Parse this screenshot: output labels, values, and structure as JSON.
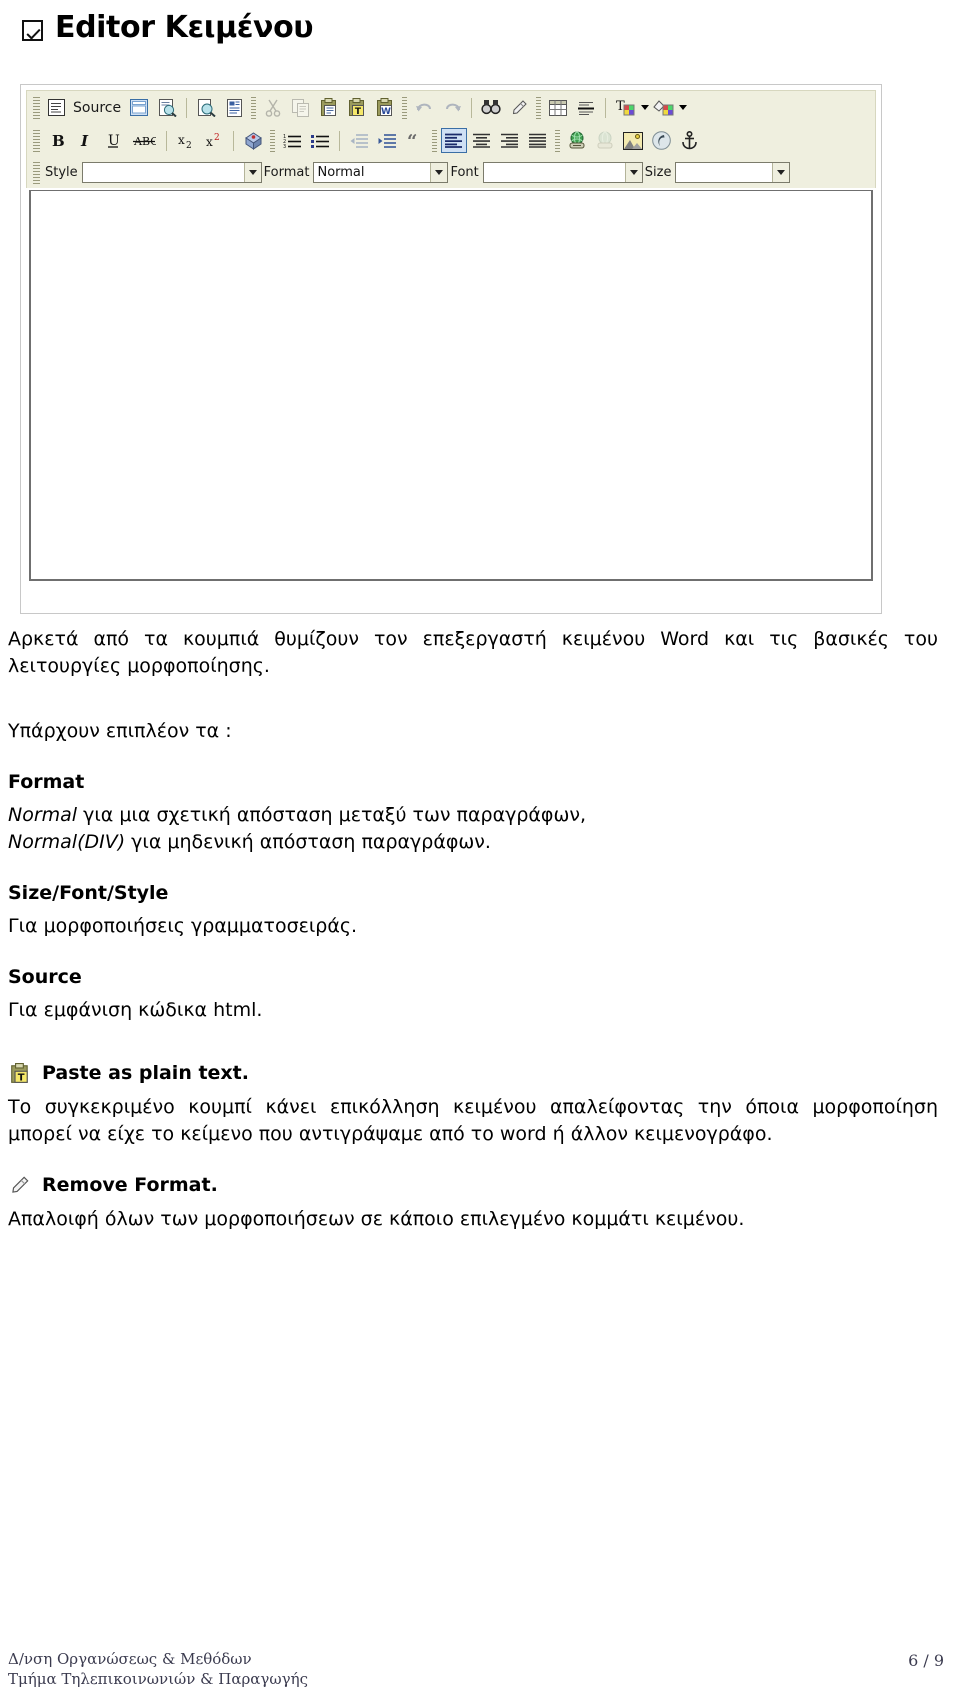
{
  "document": {
    "title": "Editor Κειμένου",
    "title_icon": "checkbox-checked-icon"
  },
  "editor": {
    "toolbar_row1": [
      {
        "name": "source-button",
        "label": "Source",
        "icon": "source-code-icon"
      },
      {
        "name": "templates-button",
        "label": "",
        "icon": "templates-icon"
      },
      {
        "name": "preview-button",
        "label": "",
        "icon": "preview-page-icon"
      },
      {
        "name": "zoom-button",
        "label": "",
        "icon": "magnifier-icon"
      },
      {
        "name": "new-page-button",
        "label": "",
        "icon": "new-page-icon"
      },
      {
        "name": "cut-button",
        "label": "",
        "icon": "scissors-icon"
      },
      {
        "name": "copy-button",
        "label": "",
        "icon": "copy-icon"
      },
      {
        "name": "paste-button",
        "label": "",
        "icon": "paste-icon"
      },
      {
        "name": "paste-text-button",
        "label": "",
        "icon": "paste-as-plain-text-icon"
      },
      {
        "name": "paste-word-button",
        "label": "",
        "icon": "paste-from-word-icon"
      },
      {
        "name": "undo-button",
        "label": "",
        "icon": "undo-arrow-icon"
      },
      {
        "name": "redo-button",
        "label": "",
        "icon": "redo-arrow-icon"
      },
      {
        "name": "find-replace-button",
        "label": "",
        "icon": "binoculars-icon"
      },
      {
        "name": "remove-format-button",
        "label": "",
        "icon": "eraser-icon"
      },
      {
        "name": "table-button",
        "label": "",
        "icon": "table-icon"
      },
      {
        "name": "horizontal-rule-button",
        "label": "",
        "icon": "horizontal-rule-icon"
      },
      {
        "name": "text-color-button",
        "label": "",
        "icon": "text-color-icon"
      },
      {
        "name": "background-color-button",
        "label": "",
        "icon": "background-color-icon"
      }
    ],
    "toolbar_row2": [
      {
        "name": "bold-button",
        "label": "B",
        "icon": "bold-icon"
      },
      {
        "name": "italic-button",
        "label": "I",
        "icon": "italic-icon"
      },
      {
        "name": "underline-button",
        "label": "U",
        "icon": "underline-icon"
      },
      {
        "name": "strikethrough-button",
        "label": "ABC",
        "icon": "strikethrough-icon"
      },
      {
        "name": "subscript-button",
        "label": "x2",
        "icon": "subscript-icon"
      },
      {
        "name": "superscript-button",
        "label": "x2",
        "icon": "superscript-icon"
      },
      {
        "name": "special-character-button",
        "label": "",
        "icon": "special-character-icon"
      },
      {
        "name": "numbered-list-button",
        "label": "",
        "icon": "numbered-list-icon"
      },
      {
        "name": "bulleted-list-button",
        "label": "",
        "icon": "bulleted-list-icon"
      },
      {
        "name": "outdent-button",
        "label": "",
        "icon": "decrease-indent-icon"
      },
      {
        "name": "indent-button",
        "label": "",
        "icon": "increase-indent-icon"
      },
      {
        "name": "blockquote-button",
        "label": "",
        "icon": "blockquote-quote-icon"
      },
      {
        "name": "align-left-button",
        "label": "",
        "icon": "align-left-icon",
        "state": "active"
      },
      {
        "name": "align-center-button",
        "label": "",
        "icon": "align-center-icon"
      },
      {
        "name": "align-right-button",
        "label": "",
        "icon": "align-right-icon"
      },
      {
        "name": "justify-button",
        "label": "",
        "icon": "align-justify-icon"
      },
      {
        "name": "link-button",
        "label": "",
        "icon": "link-globe-icon"
      },
      {
        "name": "unlink-button",
        "label": "",
        "icon": "unlink-globe-icon"
      },
      {
        "name": "image-button",
        "label": "",
        "icon": "image-icon"
      },
      {
        "name": "flash-button",
        "label": "",
        "icon": "flash-icon"
      },
      {
        "name": "anchor-button",
        "label": "",
        "icon": "anchor-icon"
      }
    ],
    "fields": {
      "style_label": "Style",
      "style_value": "",
      "format_label": "Format",
      "format_value": "Normal",
      "font_label": "Font",
      "font_value": "",
      "size_label": "Size",
      "size_value": ""
    },
    "editing_area_content": ""
  },
  "body": {
    "intro": "Αρκετά από τα κουμπιά θυμίζουν τον επεξεργαστή κειμένου Word και τις βασικές του λειτουργίες μορφοποίησης.",
    "extras_lead": "Υπάρχουν επιπλέον τα :",
    "sections": [
      {
        "heading": "Format",
        "line1_em": "Normal",
        "line1_rest": " για μια σχετική απόσταση μεταξύ των παραγράφων,",
        "line2_em": "Normal(DIV)",
        "line2_rest": " για μηδενική απόσταση παραγράφων."
      },
      {
        "heading": "Size/Font/Style",
        "text": "Για μορφοποιήσεις γραμματοσειράς."
      },
      {
        "heading": "Source",
        "text": "Για εμφάνιση κώδικα html."
      }
    ],
    "features": [
      {
        "icon": "paste-as-plain-text-icon",
        "heading": "Paste as plain text.",
        "text": "Το συγκεκριμένο κουμπί κάνει επικόλληση κειμένου απαλείφοντας την όποια μορφοποίηση μπορεί να είχε το κείμενο που αντιγράψαμε από το word ή άλλον κειμενογράφο."
      },
      {
        "icon": "eraser-icon",
        "heading": "Remove Format.",
        "text": "Απαλοιφή όλων των μορφοποιήσεων σε κάποιο επιλεγμένο κομμάτι κειμένου."
      }
    ]
  },
  "footer": {
    "line1": "Δ/νση Οργανώσεως & Μεθόδων",
    "line2": "Τμήμα Τηλεπικοινωνιών & Παραγωγής",
    "page": "6 / 9"
  },
  "colors": {
    "toolbar_bg": "#efefdf",
    "toolbar_border": "#d7d7bf",
    "active_button_bg": "#cfe0f4",
    "active_button_border": "#3a6ea5",
    "footer_text": "#3b3b4f"
  }
}
